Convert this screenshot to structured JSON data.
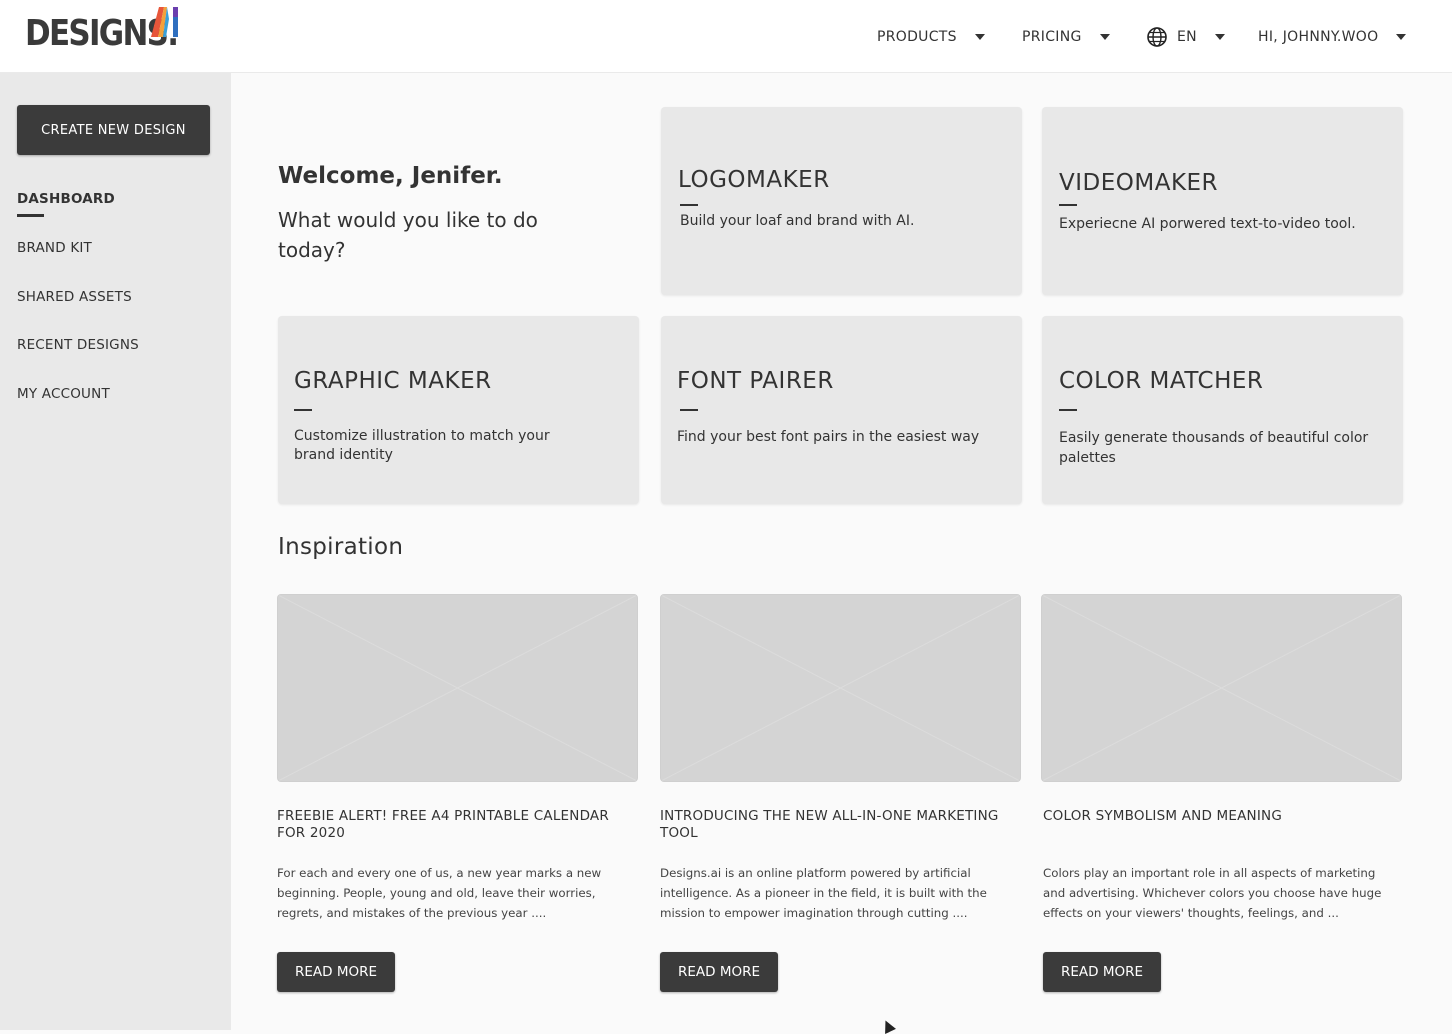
{
  "header": {
    "logo_text": "DESIGNS.",
    "logo_mark_text": "AI",
    "nav": {
      "products": "PRODUCTS",
      "pricing": "PRICING",
      "language": "EN",
      "user": "HI, JOHNNY.WOO"
    }
  },
  "sidebar": {
    "create_button": "CREATE NEW DESIGN",
    "items": [
      {
        "label": "DASHBOARD",
        "active": true
      },
      {
        "label": "BRAND KIT"
      },
      {
        "label": "SHARED ASSETS"
      },
      {
        "label": "RECENT DESIGNS"
      },
      {
        "label": "MY ACCOUNT"
      }
    ]
  },
  "welcome": {
    "title": "Welcome, Jenifer.",
    "subtitle": "What would you like to do today?"
  },
  "tools": [
    {
      "title": "LOGOMAKER",
      "description": "Build your loaf and brand with AI."
    },
    {
      "title": "VIDEOMAKER",
      "description": "Experiecne AI porwered text-to-video tool."
    },
    {
      "title": "GRAPHIC MAKER",
      "description": "Customize illustration to match your brand identity"
    },
    {
      "title": "FONT PAIRER",
      "description": "Find your best font pairs in the easiest way"
    },
    {
      "title": "COLOR MATCHER",
      "description": "Easily generate thousands of beautiful color palettes"
    }
  ],
  "inspiration": {
    "title": "Inspiration",
    "articles": [
      {
        "title": "FREEBIE ALERT! FREE A4 PRINTABLE CALENDAR FOR 2020",
        "text": "For each and every one of us, a new year marks a new beginning. People, young and old, leave their worries, regrets, and mistakes of the previous year ....",
        "button": "READ MORE"
      },
      {
        "title": "INTRODUCING THE NEW ALL-IN-ONE MARKETING TOOL",
        "text": "Designs.ai is an online platform powered by artificial intelligence.  As a pioneer in the field, it is built with the mission to empower imagination through cutting ....",
        "button": "READ MORE"
      },
      {
        "title": "COLOR SYMBOLISM AND MEANING",
        "text": "Colors play an important role in all aspects of marketing and advertising. Whichever colors you choose have huge effects on your viewers' thoughts, feelings, and ...",
        "button": "READ MORE"
      }
    ]
  },
  "colors": {
    "dark_button": "#3b3b3b",
    "sidebar_bg": "#e9e9e9",
    "card_bg": "#e8e8e8",
    "placeholder_bg": "#d4d4d4"
  }
}
